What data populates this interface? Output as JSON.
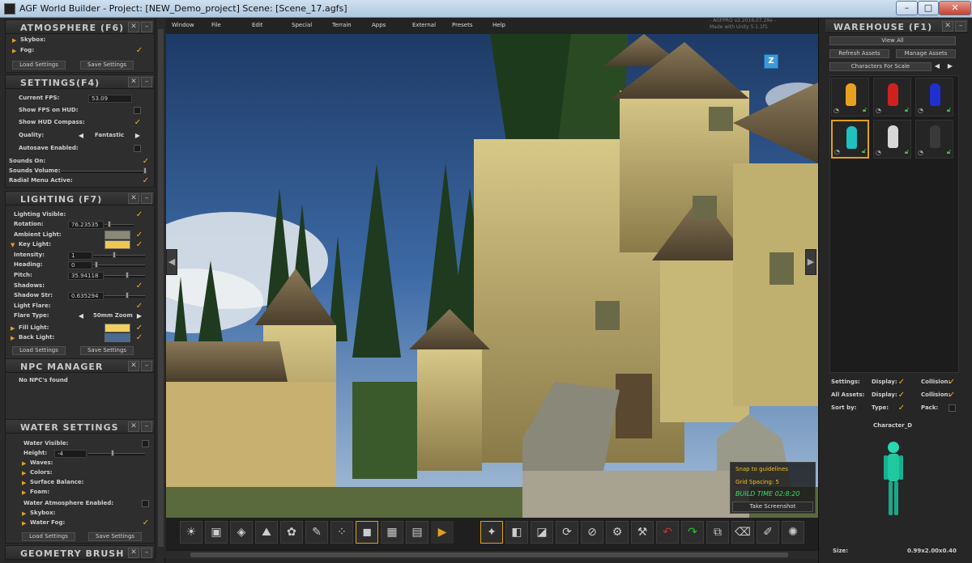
{
  "window": {
    "title": "AGF World Builder - Project: [NEW_Demo_project] Scene: [Scene_17.agfs]",
    "min": "–",
    "max": "□",
    "close": "✕"
  },
  "watermark": {
    "line1": "- AGFPRO v2.2016.07.29e -",
    "line2": "Made with Unity 5.1.1f1"
  },
  "menu": [
    "Window",
    "File",
    "Edit",
    "Special",
    "Terrain",
    "Apps",
    "External",
    "Presets",
    "Help"
  ],
  "atmosphere": {
    "title": "ATMOSPHERE (F6)",
    "skybox": "Skybox:",
    "fog": "Fog:",
    "load": "Load Settings",
    "save": "Save Settings"
  },
  "settings": {
    "title": "SETTINGS(F4)",
    "fps_label": "Current FPS:",
    "fps_value": "53.09",
    "show_fps": "Show FPS on HUD:",
    "show_compass": "Show HUD Compass:",
    "quality": "Quality:",
    "quality_value": "Fantastic",
    "autosave": "Autosave Enabled:",
    "sounds_on": "Sounds On:",
    "sounds_volume": "Sounds Volume:",
    "radial": "Radial Menu Active:"
  },
  "lighting": {
    "title": "LIGHTING (F7)",
    "visible": "Lighting Visible:",
    "rotation": "Rotation:",
    "rotation_value": "76.23535",
    "ambient": "Ambient Light:",
    "key": "Key Light:",
    "intensity": "Intensity:",
    "intensity_value": "1",
    "heading": "Heading:",
    "heading_value": "0",
    "pitch": "Pitch:",
    "pitch_value": "35.94118",
    "shadows": "Shadows:",
    "shadow_str": "Shadow Str:",
    "shadow_str_value": "0.635294",
    "light_flare": "Light Flare:",
    "flare_type": "Flare Type:",
    "flare_value": "50mm Zoom",
    "fill": "Fill Light:",
    "back": "Back Light:",
    "load": "Load Settings",
    "save": "Save Settings",
    "ambient_color": "#8c8878",
    "key_color": "#f0c850",
    "fill_color": "#f0d060",
    "back_color": "#4a6a90"
  },
  "npc": {
    "title": "NPC MANAGER",
    "none": "No NPC's found"
  },
  "water": {
    "title": "WATER SETTINGS",
    "visible": "Water Visible:",
    "height": "Height:",
    "height_value": "-4",
    "waves": "Waves:",
    "colors": "Colors:",
    "surface": "Surface Balance:",
    "foam": "Foam:",
    "atmos": "Water Atmosphere Enabled:",
    "skybox": "Skybox:",
    "fog": "Water Fog:",
    "load": "Load Settings",
    "save": "Save Settings"
  },
  "geometry": {
    "title": "GEOMETRY BRUSH"
  },
  "snap": {
    "guidelines": "Snap to guidelines",
    "grid": "Grid Spacing: 5",
    "build_time": "BUILD TIME 02:8:20",
    "screenshot": "Take Screenshot"
  },
  "gizmo": {
    "axis": "Z"
  },
  "warehouse": {
    "title": "WAREHOUSE (F1)",
    "view_all": "View All",
    "refresh": "Refresh Assets",
    "manage": "Manage Assets",
    "category": "Characters For Scale",
    "settings": "Settings:",
    "display": "Display:",
    "collision": "Collision:",
    "all_assets": "All Assets:",
    "sort_by": "Sort by:",
    "type": "Type:",
    "pack": "Pack:",
    "char_name": "Character_D",
    "size_label": "Size:",
    "size_value": "0.99x2.00x0.40",
    "slots": [
      {
        "color": "#e8a020"
      },
      {
        "color": "#d02020"
      },
      {
        "color": "#2030d0"
      },
      {
        "color": "#20c0c0"
      },
      {
        "color": "#d8d8d8"
      },
      {
        "color": "#3a3a3a"
      }
    ]
  },
  "icons": {
    "check": "✓",
    "tri_right": "▶",
    "tri_down": "▼",
    "arrow_left": "◀",
    "arrow_right": "▶"
  }
}
